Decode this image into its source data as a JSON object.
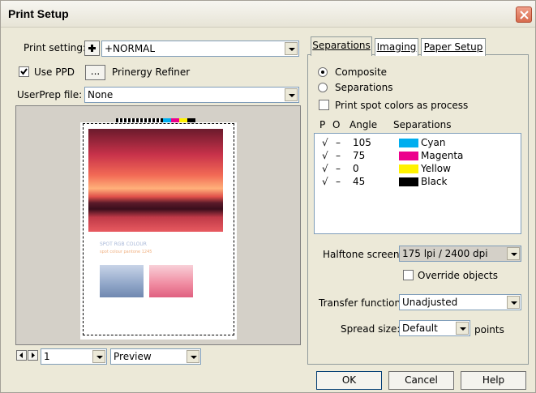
{
  "window": {
    "title": "Print Setup"
  },
  "left": {
    "print_setting_label": "Print setting:",
    "print_setting_value": "+NORMAL",
    "use_ppd_label": "Use PPD",
    "ppd_browse_label": "...",
    "ppd_name": "Prinergy Refiner",
    "userprep_label": "UserPrep file:",
    "userprep_value": "None",
    "preview": {
      "heading": "SPOT RGB COLOUR",
      "subtext": "spot colour pantone 1245"
    },
    "page_value": "1",
    "view_value": "Preview"
  },
  "tabs": [
    "Separations",
    "Imaging",
    "Paper Setup"
  ],
  "separations": {
    "composite_label": "Composite",
    "separations_label": "Separations",
    "spot_label": "Print spot colors as process",
    "col_p": "P",
    "col_o": "O",
    "col_angle": "Angle",
    "col_separations": "Separations",
    "rows": [
      {
        "p": "√",
        "o": "–",
        "angle": "105",
        "name": "Cyan",
        "color": "#00aeef"
      },
      {
        "p": "√",
        "o": "–",
        "angle": "75",
        "name": "Magenta",
        "color": "#ec008c"
      },
      {
        "p": "√",
        "o": "–",
        "angle": "0",
        "name": "Yellow",
        "color": "#fff200"
      },
      {
        "p": "√",
        "o": "–",
        "angle": "45",
        "name": "Black",
        "color": "#000000"
      }
    ],
    "halftone_label": "Halftone screen:",
    "halftone_value": "175 lpi / 2400 dpi",
    "override_label": "Override objects",
    "transfer_label": "Transfer function:",
    "transfer_value": "Unadjusted",
    "spread_label": "Spread size:",
    "spread_value": "Default",
    "spread_unit": "points"
  },
  "buttons": {
    "ok": "OK",
    "cancel": "Cancel",
    "help": "Help"
  }
}
